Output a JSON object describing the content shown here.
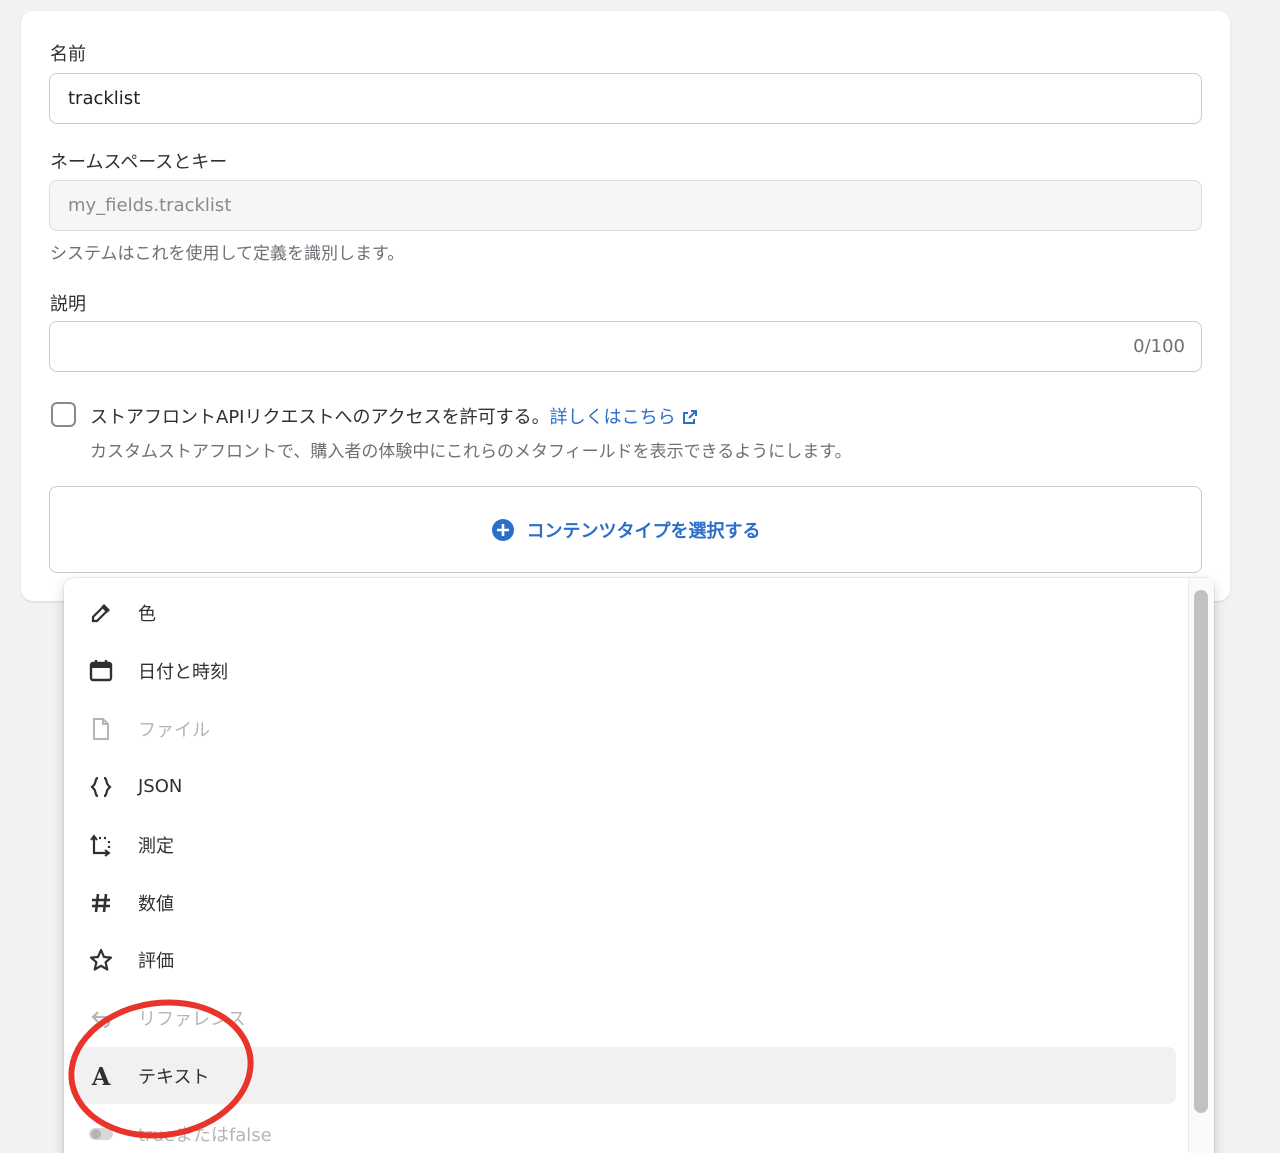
{
  "form": {
    "name_label": "名前",
    "name_value": "tracklist",
    "key_label": "ネームスペースとキー",
    "key_value": "my_fields.tracklist",
    "key_help": "システムはこれを使用して定義を識別します。",
    "desc_label": "説明",
    "desc_counter": "0/100",
    "storefront_label": "ストアフロントAPIリクエストへのアクセスを許可する。",
    "storefront_link": "詳しくはこちら",
    "storefront_help": "カスタムストアフロントで、購入者の体験中にこれらのメタフィールドを表示できるようにします。",
    "select_content_type": "コンテンツタイプを選択する"
  },
  "dropdown": {
    "options": [
      {
        "label": "色",
        "icon": "eyedropper-icon",
        "disabled": false
      },
      {
        "label": "日付と時刻",
        "icon": "calendar-icon",
        "disabled": false
      },
      {
        "label": "ファイル",
        "icon": "file-icon",
        "disabled": true
      },
      {
        "label": "JSON",
        "icon": "braces-icon",
        "disabled": false
      },
      {
        "label": "測定",
        "icon": "measurement-icon",
        "disabled": false
      },
      {
        "label": "数値",
        "icon": "hash-icon",
        "disabled": false
      },
      {
        "label": "評価",
        "icon": "star-icon",
        "disabled": false
      },
      {
        "label": "リファレンス",
        "icon": "reference-icon",
        "disabled": true
      },
      {
        "label": "テキスト",
        "icon": "text-a-icon",
        "disabled": false,
        "highlighted": true
      },
      {
        "label": "trueまたはfalse",
        "icon": "toggle-icon",
        "disabled": true
      }
    ]
  },
  "colors": {
    "link": "#2c6ecb",
    "annotation": "#e8352b"
  }
}
